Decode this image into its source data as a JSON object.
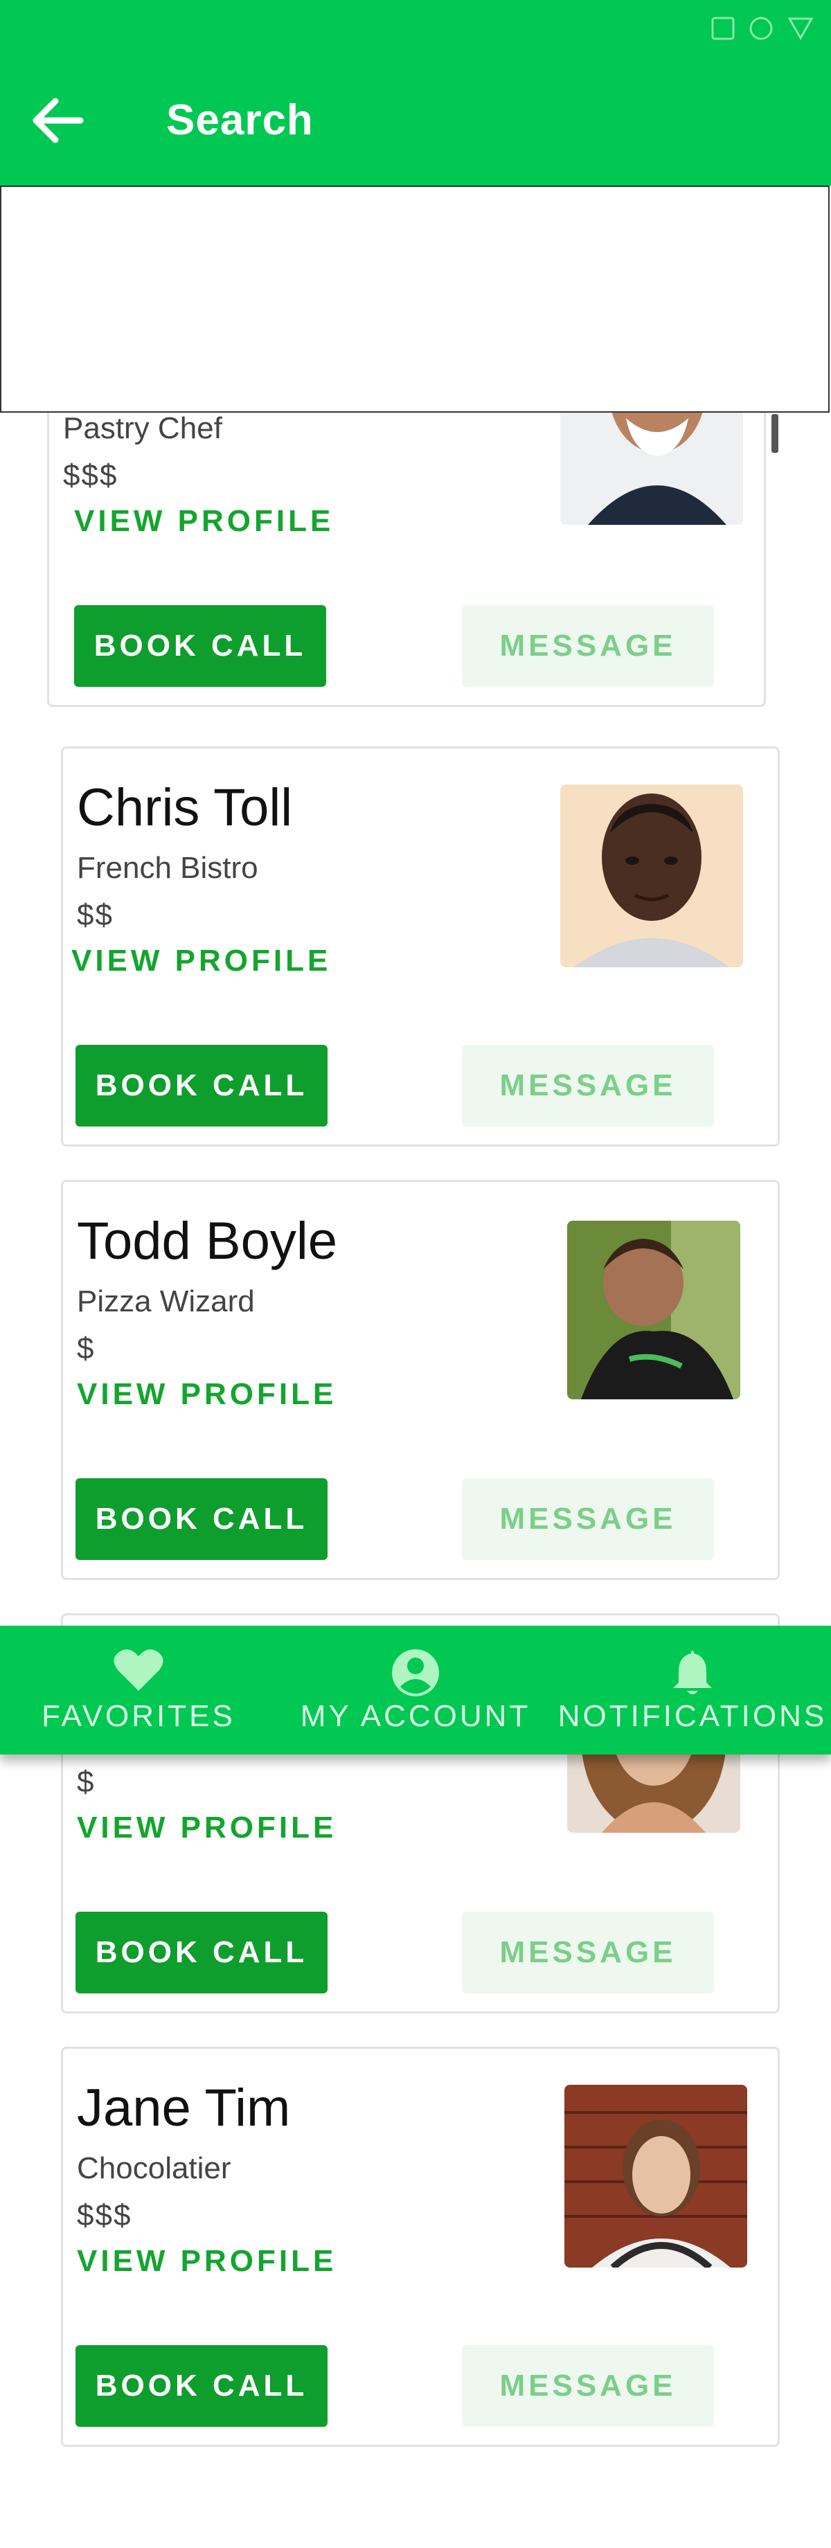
{
  "app_bar": {
    "title": "Search"
  },
  "colors": {
    "brand": "#00c853",
    "button": "#0e9e2d",
    "link": "#14a52e",
    "message_bg": "#eef8ef",
    "message_text": "#7bcf8a"
  },
  "chefs": [
    {
      "name": "",
      "specialty": "Pastry Chef",
      "price": "$$$",
      "view_label": "VIEW PROFILE",
      "book_label": "BOOK CALL",
      "message_label": "MESSAGE"
    },
    {
      "name": "Chris Toll",
      "specialty": "French Bistro",
      "price": "$$",
      "view_label": "VIEW PROFILE",
      "book_label": "BOOK CALL",
      "message_label": "MESSAGE"
    },
    {
      "name": "Todd Boyle",
      "specialty": "Pizza Wizard",
      "price": "$",
      "view_label": "VIEW PROFILE",
      "book_label": "BOOK CALL",
      "message_label": "MESSAGE"
    },
    {
      "name": "",
      "specialty": "",
      "price": "$",
      "view_label": "VIEW PROFILE",
      "book_label": "BOOK CALL",
      "message_label": "MESSAGE"
    },
    {
      "name": "Jane Tim",
      "specialty": "Chocolatier",
      "price": "$$$",
      "view_label": "VIEW PROFILE",
      "book_label": "BOOK CALL",
      "message_label": "MESSAGE"
    }
  ],
  "bottom_nav": {
    "favorites": "FAVORITES",
    "account": "MY ACCOUNT",
    "notifications": "NOTIFICATIONS"
  },
  "icons": {
    "status": [
      "square-icon",
      "circle-icon",
      "triangle-icon"
    ],
    "back": "arrow-left-icon",
    "favorites": "heart-icon",
    "account": "account-circle-icon",
    "notifications": "bell-icon"
  }
}
